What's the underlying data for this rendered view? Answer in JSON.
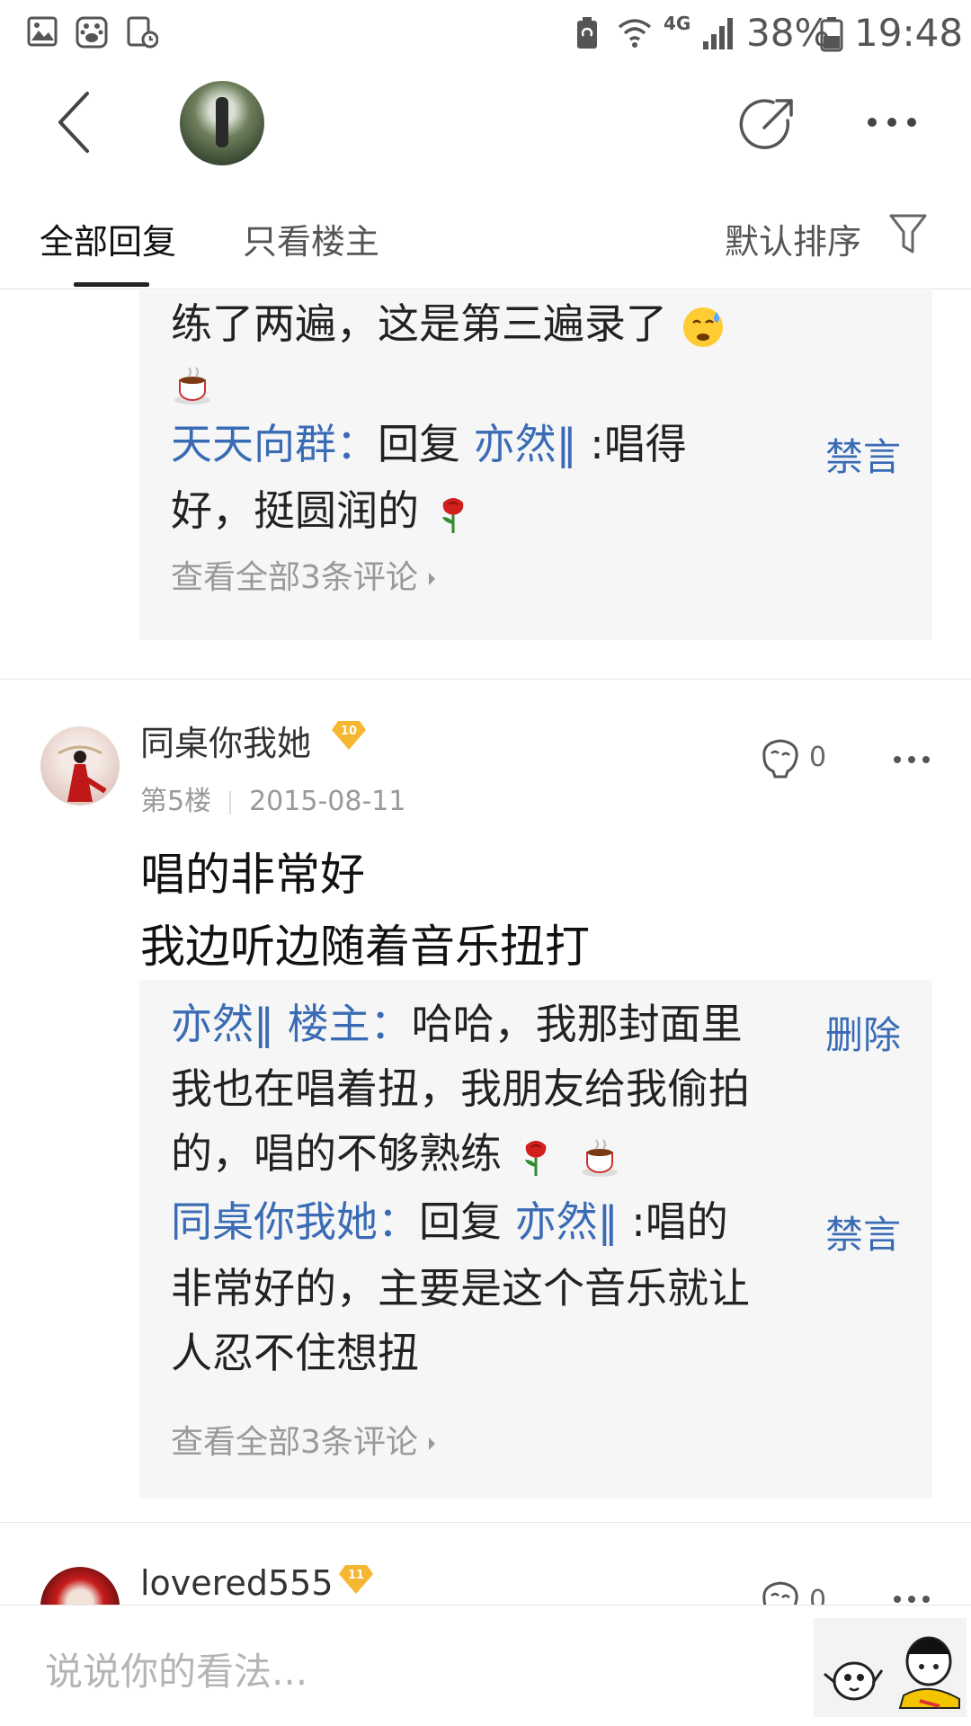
{
  "status_bar": {
    "network": "4G",
    "battery": "38%",
    "time": "19:48"
  },
  "tabs": {
    "all_replies": "全部回复",
    "host_only": "只看楼主",
    "sort": "默认排序"
  },
  "prev_post": {
    "content_tail": "练了两遍，这是第三遍录了",
    "reply": {
      "user": "天天向群",
      "colon": "：",
      "prefix": "回复",
      "target": "亦然‖",
      "text_1": ":唱得",
      "text_2": "好，挺圆润的",
      "action": "禁言"
    },
    "view_all": "查看全部3条评论"
  },
  "post_5": {
    "username": "同桌你我她",
    "level": "10",
    "floor": "第5楼",
    "date": "2015-08-11",
    "likes": "0",
    "content": [
      "唱的非常好",
      "我边听边随着音乐扭打"
    ],
    "replies": [
      {
        "user": "亦然‖",
        "badge": "楼主",
        "colon": "：",
        "lines": [
          "哈哈，我那封面里",
          "我也在唱着扭，我朋友给我偷拍",
          "的，唱的不够熟练"
        ],
        "action": "删除"
      },
      {
        "user": "同桌你我她",
        "colon": "：",
        "prefix": "回复",
        "target": "亦然‖",
        "lines": [
          ":唱的",
          "非常好的，主要是这个音乐就让",
          "人忍不住想扭"
        ],
        "action": "禁言"
      }
    ],
    "view_all": "查看全部3条评论"
  },
  "post_6": {
    "username": "lovered555",
    "level": "11",
    "likes": "0"
  },
  "bottom_bar": {
    "placeholder": "说说你的看法..."
  },
  "colors": {
    "link_blue": "#3a6bb5",
    "reply_bg": "#f6f6f6",
    "level_badge": "#f5b731"
  }
}
